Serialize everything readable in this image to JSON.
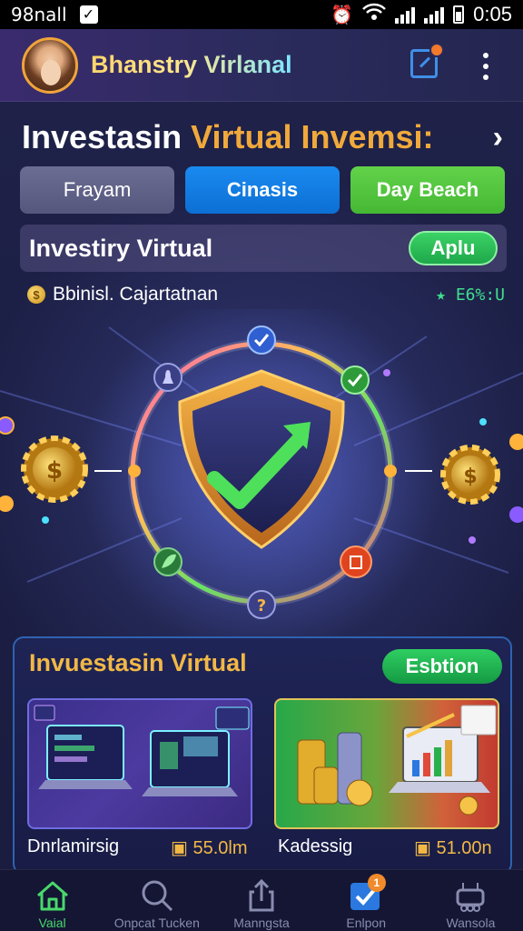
{
  "status_bar": {
    "carrier": "98nall",
    "time": "0:05"
  },
  "header": {
    "app_name": "Bhanstry Virlanal",
    "avatar": "user-avatar",
    "edit_icon": "edit-icon",
    "menu_icon": "more-vertical-icon"
  },
  "title": {
    "part1": "Investasin ",
    "part2": "Virtual Invemsi:"
  },
  "tabs": [
    {
      "label": "Frayam"
    },
    {
      "label": "Cinasis"
    },
    {
      "label": "Day Beach"
    }
  ],
  "investment_bar": {
    "title": "Investiry Virtual",
    "button": "Aplu"
  },
  "balance": {
    "icon": "dollar-coin-icon",
    "label": "Bbinisl. Cajartatnan",
    "value": "★ E6%:U"
  },
  "hero": {
    "shield_icon": "shield-check-icon",
    "orbit_icons": [
      "check-icon",
      "check-icon",
      "trash-icon",
      "question-icon",
      "leaf-icon",
      "bell-icon"
    ],
    "gear_icons": [
      "dollar-gear-icon",
      "dollar-gear-icon"
    ]
  },
  "panel": {
    "title": "Invuestasin Virtual",
    "button": "Esbtion",
    "cards": [
      {
        "label": "Dnrlamirsig",
        "value": "55.0lm",
        "value_icon": "wallet-icon"
      },
      {
        "label": "Kadessig",
        "value": "51.00n",
        "value_icon": "wallet-icon"
      }
    ]
  },
  "bottom_nav": [
    {
      "label": "Vaial",
      "icon": "home-icon",
      "active": true
    },
    {
      "label": "Onpcat Tucken",
      "icon": "search-icon",
      "active": false
    },
    {
      "label": "Manngsta",
      "icon": "share-icon",
      "active": false
    },
    {
      "label": "Enlpon",
      "icon": "checkbox-icon",
      "active": false,
      "badge": "1"
    },
    {
      "label": "Wansola",
      "icon": "robot-icon",
      "active": false
    }
  ],
  "colors": {
    "accent_gold": "#f0a93b",
    "accent_green": "#3bd266",
    "accent_blue": "#1a8af0",
    "background": "#1b1d3d"
  }
}
